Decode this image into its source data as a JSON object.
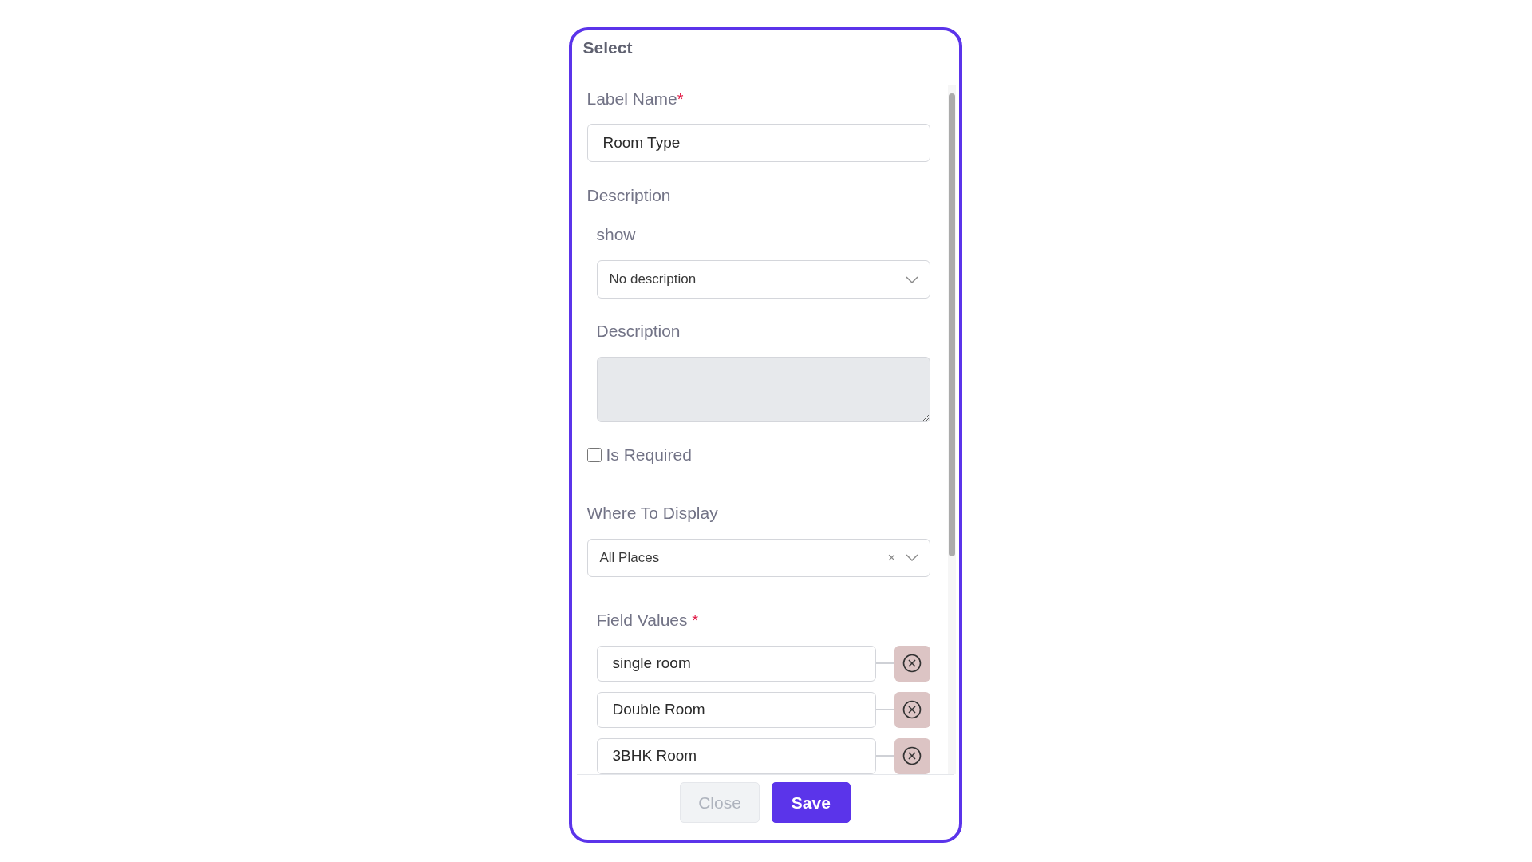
{
  "dialog": {
    "title": "Select"
  },
  "label_name": {
    "label": "Label Name",
    "required": true,
    "required_mark": "*",
    "value": "Room Type"
  },
  "description": {
    "label": "Description",
    "show": {
      "label": "show",
      "value": "No description"
    },
    "text": {
      "label": "Description",
      "disabled": true
    }
  },
  "is_required": {
    "label": "Is Required",
    "checked": false
  },
  "where_to_display": {
    "label": "Where To Display",
    "value": "All Places",
    "clear": "×"
  },
  "field_values": {
    "label": "Field Values",
    "required": true,
    "required_mark": "*",
    "items": [
      {
        "value": "single room"
      },
      {
        "value": "Double Room"
      },
      {
        "value": "3BHK Room"
      }
    ]
  },
  "buttons": [
    {
      "label": "Close",
      "kind": "secondary"
    },
    {
      "label": "Save",
      "kind": "primary"
    }
  ]
}
